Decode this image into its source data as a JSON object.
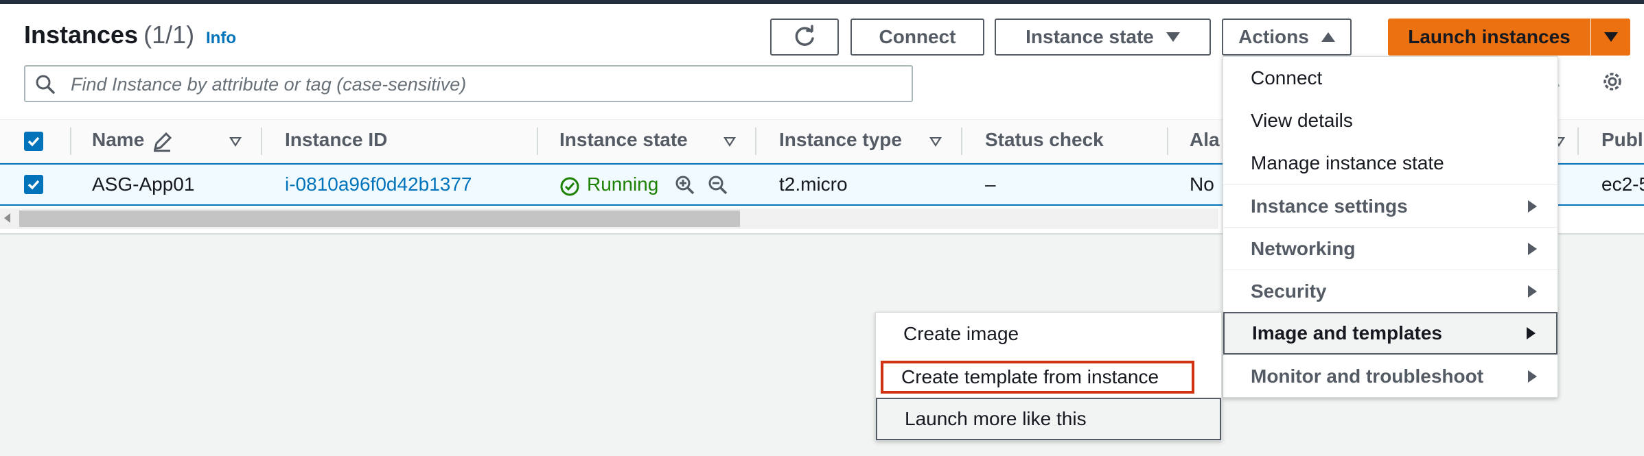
{
  "header": {
    "title": "Instances",
    "count": "(1/1)",
    "info": "Info"
  },
  "toolbar": {
    "refresh_icon": "refresh-icon",
    "connect": "Connect",
    "instance_state": "Instance state",
    "actions": "Actions",
    "launch": "Launch instances"
  },
  "search": {
    "placeholder": "Find Instance by attribute or tag (case-sensitive)"
  },
  "table": {
    "columns": [
      "Name",
      "Instance ID",
      "Instance state",
      "Instance type",
      "Status check",
      "Ala",
      "Publ"
    ],
    "rows": [
      {
        "name": "ASG-App01",
        "instance_id": "i-0810a96f0d42b1377",
        "state": "Running",
        "type": "t2.micro",
        "status_check": "–",
        "alarm": "No",
        "public": "ec2-5"
      }
    ]
  },
  "actions_menu": {
    "items": [
      {
        "label": "Connect",
        "kind": "plain"
      },
      {
        "label": "View details",
        "kind": "plain"
      },
      {
        "label": "Manage instance state",
        "kind": "plain"
      },
      {
        "label": "Instance settings",
        "kind": "category"
      },
      {
        "label": "Networking",
        "kind": "category"
      },
      {
        "label": "Security",
        "kind": "category"
      },
      {
        "label": "Image and templates",
        "kind": "category-active"
      },
      {
        "label": "Monitor and troubleshoot",
        "kind": "category"
      }
    ]
  },
  "submenu": {
    "items": [
      "Create image",
      "Create template from instance",
      "Launch more like this"
    ]
  },
  "colors": {
    "accent": "#0073bb",
    "launch": "#ec7211",
    "running": "#1d8102",
    "highlight_box": "#d13212"
  }
}
